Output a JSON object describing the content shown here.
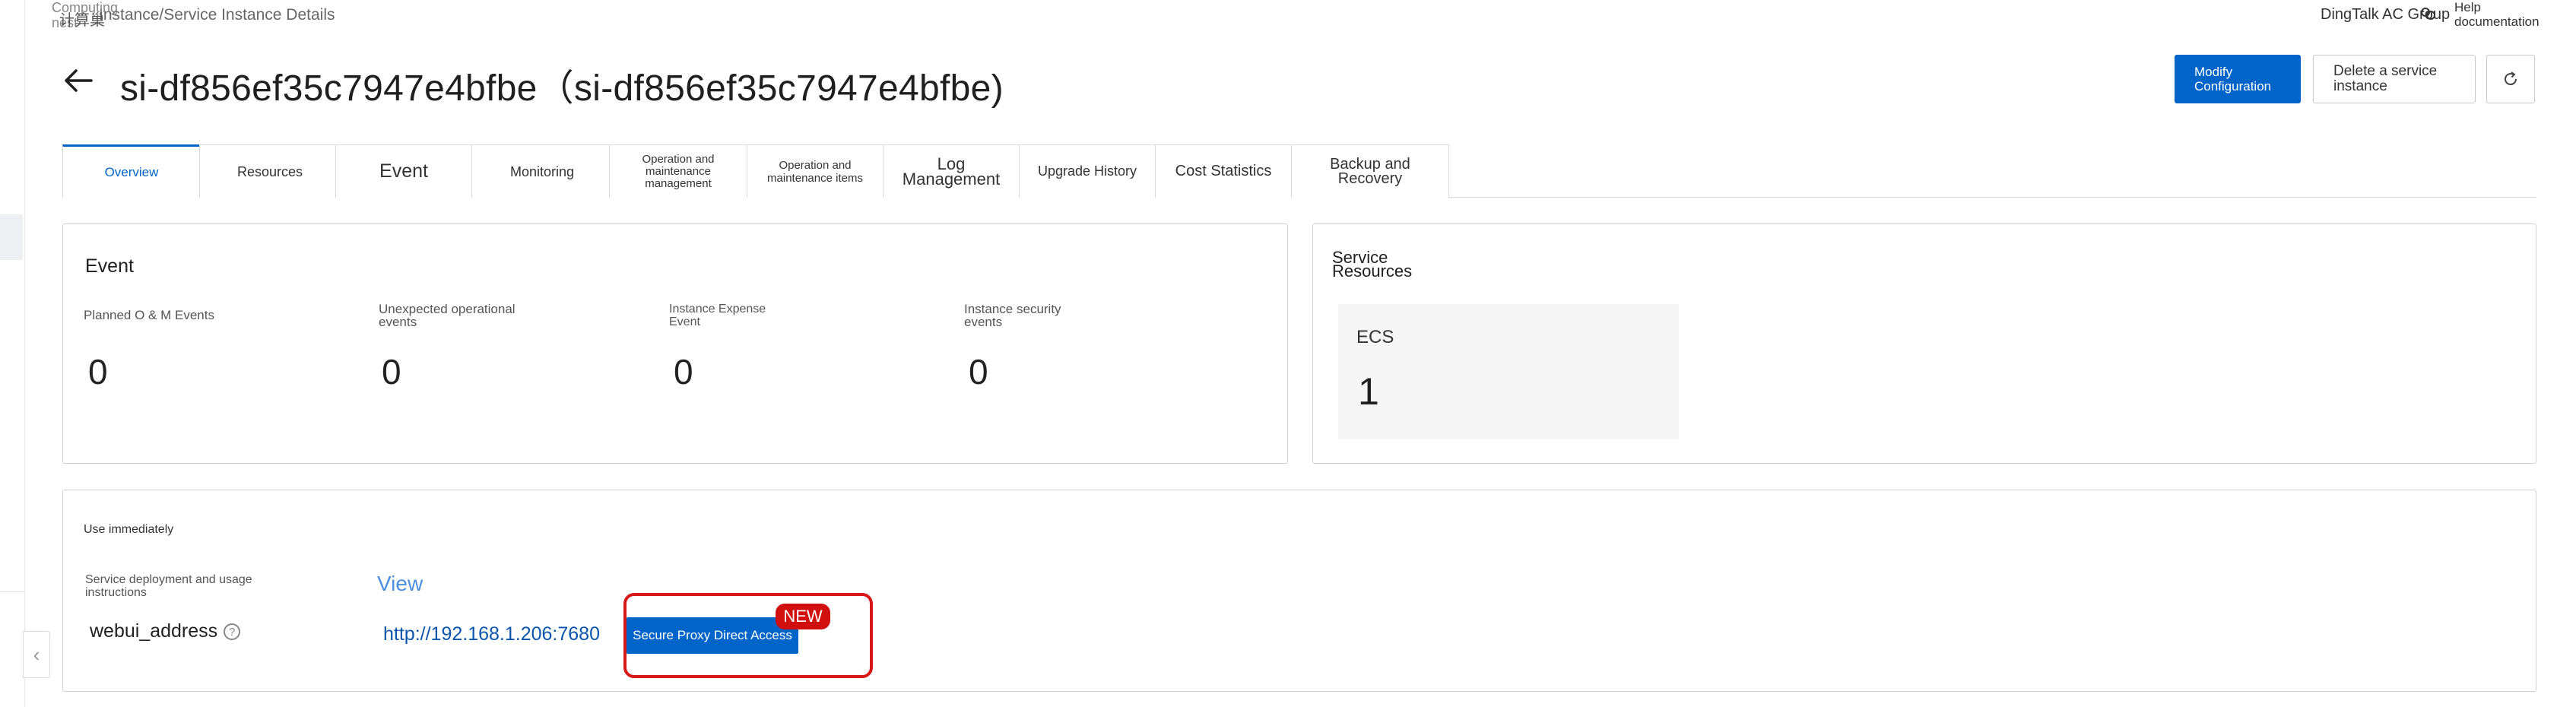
{
  "header": {
    "breadcrumb": "Instance/Service Instance Details",
    "breadcrumb_overlay": "Computing nest",
    "breadcrumb_overlay_glyphs": "计算巢",
    "dingtalk": "DingTalk AC Group",
    "help": "Help documentation"
  },
  "title": {
    "text": "si-df856ef35c7947e4bfbe（si-df856ef35c7947e4bfbe)"
  },
  "actions": {
    "modify": "Modify Configuration",
    "delete": "Delete a service instance"
  },
  "tabs": [
    {
      "label": "Overview"
    },
    {
      "label": "Resources"
    },
    {
      "label": "Event"
    },
    {
      "label": "Monitoring"
    },
    {
      "label": "Operation and maintenance management"
    },
    {
      "label": "Operation and maintenance items"
    },
    {
      "label": "Log Management"
    },
    {
      "label": "Upgrade History"
    },
    {
      "label": "Cost Statistics"
    },
    {
      "label": "Backup and Recovery"
    }
  ],
  "event_panel": {
    "title": "Event",
    "stats": [
      {
        "label": "Planned O & M Events",
        "value": "0"
      },
      {
        "label": "Unexpected operational events",
        "value": "0"
      },
      {
        "label": "Instance Expense Event",
        "value": "0"
      },
      {
        "label": "Instance security events",
        "value": "0"
      }
    ]
  },
  "resources_panel": {
    "title": "Service Resources",
    "ecs_label": "ECS",
    "ecs_value": "1"
  },
  "use_panel": {
    "title": "Use immediately",
    "instructions_label": "Service deployment and usage instructions",
    "view_link": "View",
    "webui_label": "webui_address",
    "webui_url": "http://192.168.1.206:7680",
    "proxy_button": "Secure Proxy Direct Access",
    "new_badge": "NEW"
  },
  "colors": {
    "primary": "#0064c8",
    "highlight": "#d61818",
    "link": "#0a56ad"
  }
}
